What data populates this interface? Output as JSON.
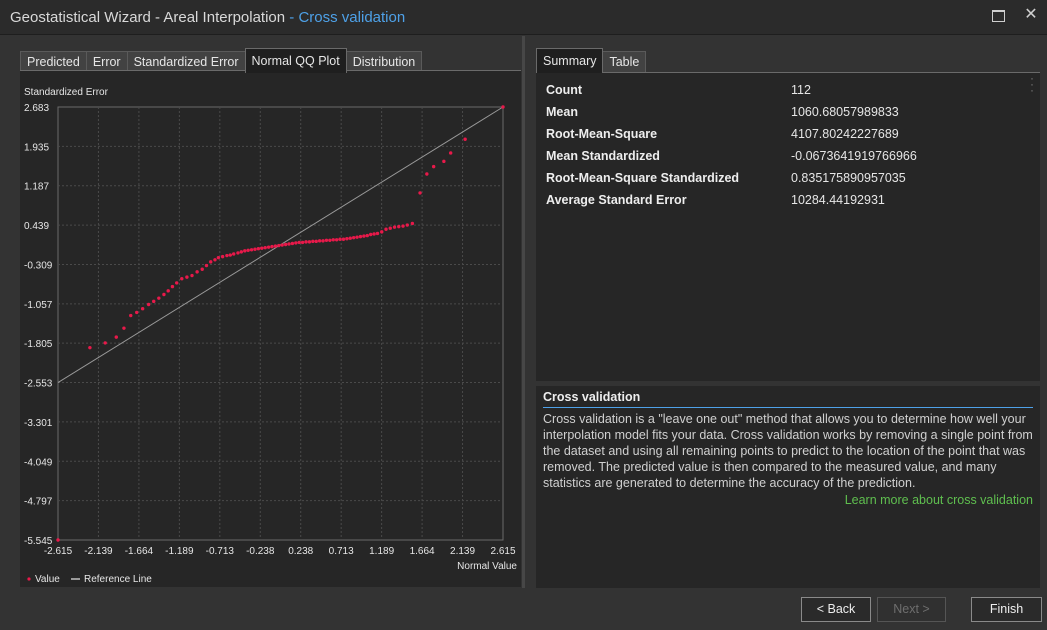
{
  "window": {
    "title_main": "Geostatistical Wizard - Areal Interpolation",
    "title_sep": " - ",
    "title_sub": "Cross validation",
    "maximize_icon": "maximize-icon",
    "close_icon": "close-icon",
    "close_glyph": "✕"
  },
  "left_tabs": [
    "Predicted",
    "Error",
    "Standardized Error",
    "Normal QQ Plot",
    "Distribution"
  ],
  "left_active_tab": "Normal QQ Plot",
  "right_tabs": [
    "Summary",
    "Table"
  ],
  "right_active_tab": "Summary",
  "menu_icon": "vertical-ellipsis-icon",
  "chart_data": {
    "type": "scatter",
    "ylabel": "Standardized Error",
    "xlabel": "Normal Value",
    "xlim": [
      -2.615,
      2.615
    ],
    "ylim": [
      -5.545,
      2.683
    ],
    "x_ticks": [
      "-2.615",
      "-2.139",
      "-1.664",
      "-1.189",
      "-0.713",
      "-0.238",
      "0.238",
      "0.713",
      "1.189",
      "1.664",
      "2.139",
      "2.615"
    ],
    "y_ticks": [
      "2.683",
      "1.935",
      "1.187",
      "0.439",
      "-0.309",
      "-1.057",
      "-1.805",
      "-2.553",
      "-3.301",
      "-4.049",
      "-4.797",
      "-5.545"
    ],
    "grid": true,
    "legend_placement": "bottom-left",
    "legend": [
      "Value",
      "Reference Line"
    ],
    "series": [
      {
        "name": "Value",
        "color": "#e8194a",
        "points": [
          [
            -2.615,
            -5.545
          ],
          [
            -2.24,
            -1.89
          ],
          [
            -2.06,
            -1.8
          ],
          [
            -1.93,
            -1.69
          ],
          [
            -1.84,
            -1.52
          ],
          [
            -1.76,
            -1.28
          ],
          [
            -1.69,
            -1.22
          ],
          [
            -1.62,
            -1.15
          ],
          [
            -1.55,
            -1.07
          ],
          [
            -1.49,
            -1.01
          ],
          [
            -1.43,
            -0.95
          ],
          [
            -1.37,
            -0.88
          ],
          [
            -1.32,
            -0.81
          ],
          [
            -1.27,
            -0.73
          ],
          [
            -1.22,
            -0.66
          ],
          [
            -1.16,
            -0.58
          ],
          [
            -1.1,
            -0.55
          ],
          [
            -1.04,
            -0.52
          ],
          [
            -0.98,
            -0.45
          ],
          [
            -0.92,
            -0.4
          ],
          [
            -0.87,
            -0.33
          ],
          [
            -0.82,
            -0.26
          ],
          [
            -0.77,
            -0.22
          ],
          [
            -0.73,
            -0.18
          ],
          [
            -0.68,
            -0.16
          ],
          [
            -0.63,
            -0.14
          ],
          [
            -0.59,
            -0.13
          ],
          [
            -0.55,
            -0.11
          ],
          [
            -0.5,
            -0.09
          ],
          [
            -0.46,
            -0.07
          ],
          [
            -0.42,
            -0.05
          ],
          [
            -0.38,
            -0.04
          ],
          [
            -0.34,
            -0.03
          ],
          [
            -0.3,
            -0.02
          ],
          [
            -0.26,
            -0.01
          ],
          [
            -0.22,
            0.0
          ],
          [
            -0.18,
            0.01
          ],
          [
            -0.14,
            0.02
          ],
          [
            -0.1,
            0.03
          ],
          [
            -0.06,
            0.04
          ],
          [
            -0.02,
            0.05
          ],
          [
            0.02,
            0.06
          ],
          [
            0.06,
            0.07
          ],
          [
            0.1,
            0.08
          ],
          [
            0.14,
            0.09
          ],
          [
            0.18,
            0.1
          ],
          [
            0.22,
            0.11
          ],
          [
            0.26,
            0.11
          ],
          [
            0.3,
            0.12
          ],
          [
            0.34,
            0.12
          ],
          [
            0.38,
            0.13
          ],
          [
            0.42,
            0.13
          ],
          [
            0.46,
            0.14
          ],
          [
            0.5,
            0.14
          ],
          [
            0.54,
            0.15
          ],
          [
            0.58,
            0.15
          ],
          [
            0.62,
            0.16
          ],
          [
            0.66,
            0.16
          ],
          [
            0.7,
            0.17
          ],
          [
            0.74,
            0.17
          ],
          [
            0.78,
            0.18
          ],
          [
            0.82,
            0.19
          ],
          [
            0.86,
            0.2
          ],
          [
            0.9,
            0.21
          ],
          [
            0.94,
            0.22
          ],
          [
            0.98,
            0.23
          ],
          [
            1.02,
            0.24
          ],
          [
            1.06,
            0.26
          ],
          [
            1.1,
            0.27
          ],
          [
            1.14,
            0.28
          ],
          [
            1.19,
            0.31
          ],
          [
            1.24,
            0.36
          ],
          [
            1.29,
            0.38
          ],
          [
            1.34,
            0.4
          ],
          [
            1.39,
            0.41
          ],
          [
            1.44,
            0.42
          ],
          [
            1.49,
            0.44
          ],
          [
            1.55,
            0.47
          ],
          [
            1.64,
            1.05
          ],
          [
            1.72,
            1.41
          ],
          [
            1.8,
            1.55
          ],
          [
            1.92,
            1.65
          ],
          [
            2.0,
            1.81
          ],
          [
            2.17,
            2.07
          ],
          [
            2.615,
            2.683
          ]
        ]
      },
      {
        "name": "Reference Line",
        "color": "#9a9a9a",
        "line": [
          [
            -2.615,
            -2.553
          ],
          [
            2.615,
            2.683
          ]
        ]
      }
    ]
  },
  "summary": [
    {
      "label": "Count",
      "value": "112"
    },
    {
      "label": "Mean",
      "value": "1060.68057989833"
    },
    {
      "label": "Root-Mean-Square",
      "value": "4107.80242227689"
    },
    {
      "label": "Mean Standardized",
      "value": "-0.0673641919766966"
    },
    {
      "label": "Root-Mean-Square Standardized",
      "value": "0.835175890957035"
    },
    {
      "label": "Average Standard Error",
      "value": "10284.44192931"
    }
  ],
  "cross_validation": {
    "header": "Cross validation",
    "text": "Cross validation is a \"leave one out\" method that allows you to determine how well your interpolation model fits your data. Cross validation works by removing a single point from the dataset and using all remaining points to predict to the location of the point that was removed. The predicted value is then compared to the measured value, and many statistics are generated to determine the accuracy of the prediction.",
    "link": "Learn more about cross validation"
  },
  "buttons": {
    "back": "< Back",
    "next": "Next >",
    "finish": "Finish"
  }
}
